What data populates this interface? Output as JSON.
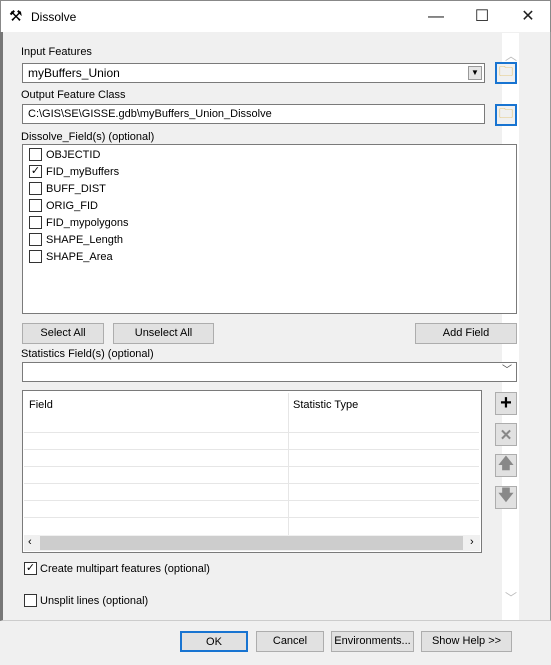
{
  "window": {
    "title": "Dissolve",
    "icon": "hammer-icon"
  },
  "input_features": {
    "label": "Input Features",
    "value": "myBuffers_Union"
  },
  "output_feature_class": {
    "label": "Output Feature Class",
    "value": "C:\\GIS\\SE\\GISSE.gdb\\myBuffers_Union_Dissolve"
  },
  "dissolve_fields": {
    "label": "Dissolve_Field(s) (optional)",
    "items": [
      {
        "label": "OBJECTID",
        "checked": false
      },
      {
        "label": "FID_myBuffers",
        "checked": true
      },
      {
        "label": "BUFF_DIST",
        "checked": false
      },
      {
        "label": "ORIG_FID",
        "checked": false
      },
      {
        "label": "FID_mypolygons",
        "checked": false
      },
      {
        "label": "SHAPE_Length",
        "checked": false
      },
      {
        "label": "SHAPE_Area",
        "checked": false
      }
    ]
  },
  "buttons": {
    "select_all": "Select All",
    "unselect_all": "Unselect All",
    "add_field": "Add Field"
  },
  "statistics": {
    "label": "Statistics Field(s) (optional)",
    "value": "",
    "columns": [
      "Field",
      "Statistic Type"
    ]
  },
  "options": {
    "multipart": {
      "label": "Create multipart features (optional)",
      "checked": true
    },
    "unsplit": {
      "label": "Unsplit lines (optional)",
      "checked": false
    }
  },
  "footer": {
    "ok": "OK",
    "cancel": "Cancel",
    "environments": "Environments...",
    "show_help": "Show Help >>"
  },
  "accent": "#1874d1"
}
